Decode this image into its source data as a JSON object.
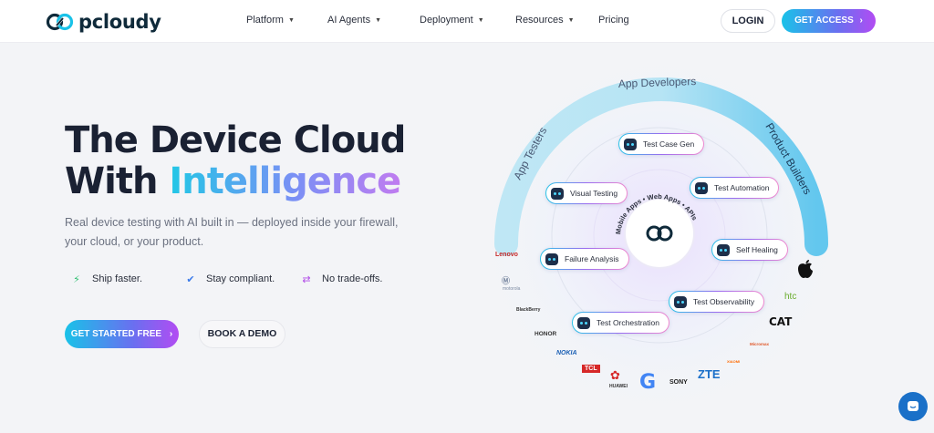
{
  "brand": {
    "name": "pcloudy"
  },
  "nav": {
    "items": [
      {
        "label": "Platform",
        "has_dropdown": true
      },
      {
        "label": "AI Agents",
        "has_dropdown": true
      },
      {
        "label": "Deployment",
        "has_dropdown": true
      },
      {
        "label": "Resources",
        "has_dropdown": true
      },
      {
        "label": "Pricing",
        "has_dropdown": false
      }
    ],
    "login_label": "LOGIN",
    "access_label": "GET ACCESS",
    "access_arrow": "›"
  },
  "hero": {
    "title_line1": "The Device Cloud",
    "title_line2_prefix": "With ",
    "title_line2_highlight": "Intelligence",
    "subtitle": "Real device testing with AI built in — deployed inside your firewall, your cloud, or your product.",
    "features": [
      {
        "label": "Ship faster.",
        "icon": "lightning-icon",
        "color": "#2fbf71"
      },
      {
        "label": "Stay compliant.",
        "icon": "shield-check-icon",
        "color": "#3b7bea"
      },
      {
        "label": "No trade-offs.",
        "icon": "swap-arrows-icon",
        "color": "#b04ae8"
      }
    ],
    "cta_primary": "GET STARTED FREE",
    "cta_primary_arrow": "›",
    "cta_secondary": "BOOK A DEMO"
  },
  "diagram": {
    "arc_labels": {
      "left": "App Testers",
      "top": "App Developers",
      "right": "Product Builders"
    },
    "center_ring_text": "Mobile Apps • Web Apps • APIs",
    "agents": [
      "Test Case Gen",
      "Visual Testing",
      "Test Automation",
      "Self Healing",
      "Failure Analysis",
      "Test Observability",
      "Test Orchestration"
    ],
    "brands": [
      "Lenovo",
      "motorola",
      "BlackBerry",
      "HONOR",
      "NOKIA",
      "TCL",
      "HUAWEI",
      "Google",
      "SONY",
      "ZTE",
      "XIAOMI",
      "Micromax",
      "CAT",
      "htc",
      "Apple"
    ]
  },
  "colors": {
    "accent_start": "#19c2e8",
    "accent_mid": "#6a6ff0",
    "accent_end": "#b24cf2",
    "title": "#1a2133",
    "chat_button": "#1a70c8"
  }
}
